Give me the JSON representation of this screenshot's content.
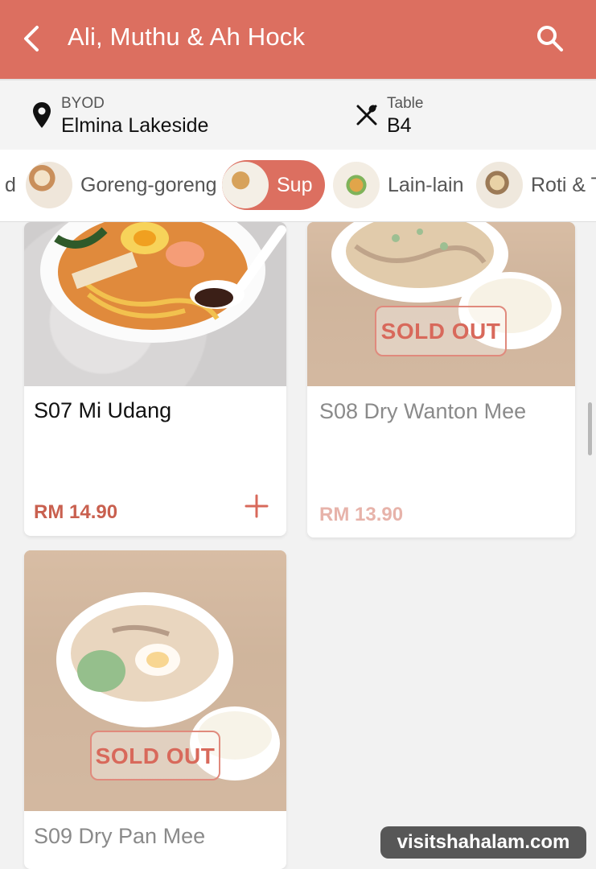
{
  "appbar": {
    "title": "Ali, Muthu & Ah Hock",
    "back_icon": "arrow-left-icon",
    "search_icon": "search-icon",
    "color": "#dc6f60"
  },
  "info": {
    "mode_label": "BYOD",
    "location": "Elmina Lakeside",
    "table_label": "Table",
    "table_value": "B4"
  },
  "categories": [
    {
      "label": "d",
      "active": false
    },
    {
      "label": "Goreng-goreng",
      "active": false
    },
    {
      "label": "Sup",
      "active": true
    },
    {
      "label": "Lain-lain",
      "active": false
    },
    {
      "label": "Roti & T",
      "active": false
    }
  ],
  "products": [
    {
      "name": "S07 Mi Udang",
      "price": "RM 14.90",
      "sold_out": false
    },
    {
      "name": "S08 Dry Wanton Mee",
      "price": "RM 13.90",
      "sold_out": true,
      "badge": "SOLD OUT"
    },
    {
      "name": "S09 Dry Pan Mee",
      "price": "",
      "sold_out": true,
      "badge": "SOLD OUT"
    }
  ],
  "watermark": "visitshahalam.com"
}
